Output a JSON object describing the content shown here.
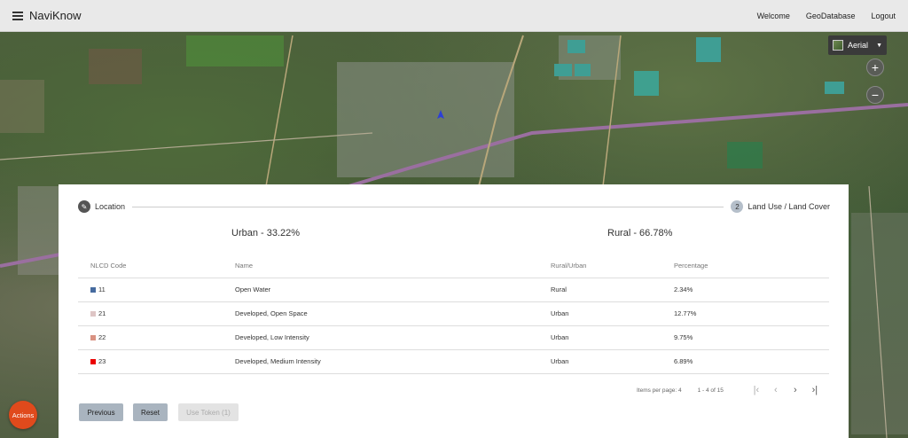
{
  "navbar": {
    "brand": "NaviKnow",
    "links": [
      "Welcome",
      "GeoDatabase",
      "Logout"
    ]
  },
  "map_controls": {
    "layer_label": "Aerial",
    "zoom_in": "+",
    "zoom_out": "−"
  },
  "stepper": {
    "step1_label": "Location",
    "step2_number": "2",
    "step2_label": "Land Use / Land Cover"
  },
  "summary": {
    "urban": "Urban - 33.22%",
    "rural": "Rural - 66.78%"
  },
  "table": {
    "headers": [
      "NLCD Code",
      "Name",
      "Rural/Urban",
      "Percentage"
    ],
    "rows": [
      {
        "code": "11",
        "name": "Open Water",
        "type": "Rural",
        "pct": "2.34%",
        "color": "#466b9f"
      },
      {
        "code": "21",
        "name": "Developed, Open Space",
        "type": "Urban",
        "pct": "12.77%",
        "color": "#dec5c5"
      },
      {
        "code": "22",
        "name": "Developed, Low Intensity",
        "type": "Urban",
        "pct": "9.75%",
        "color": "#d99282"
      },
      {
        "code": "23",
        "name": "Developed, Medium Intensity",
        "type": "Urban",
        "pct": "6.89%",
        "color": "#eb0000"
      }
    ]
  },
  "paginator": {
    "items_per_page": "Items per page: 4",
    "range": "1 - 4 of 15"
  },
  "buttons": {
    "previous": "Previous",
    "reset": "Reset",
    "use_token": "Use Token (1)"
  },
  "fab": {
    "label": "Actions"
  }
}
